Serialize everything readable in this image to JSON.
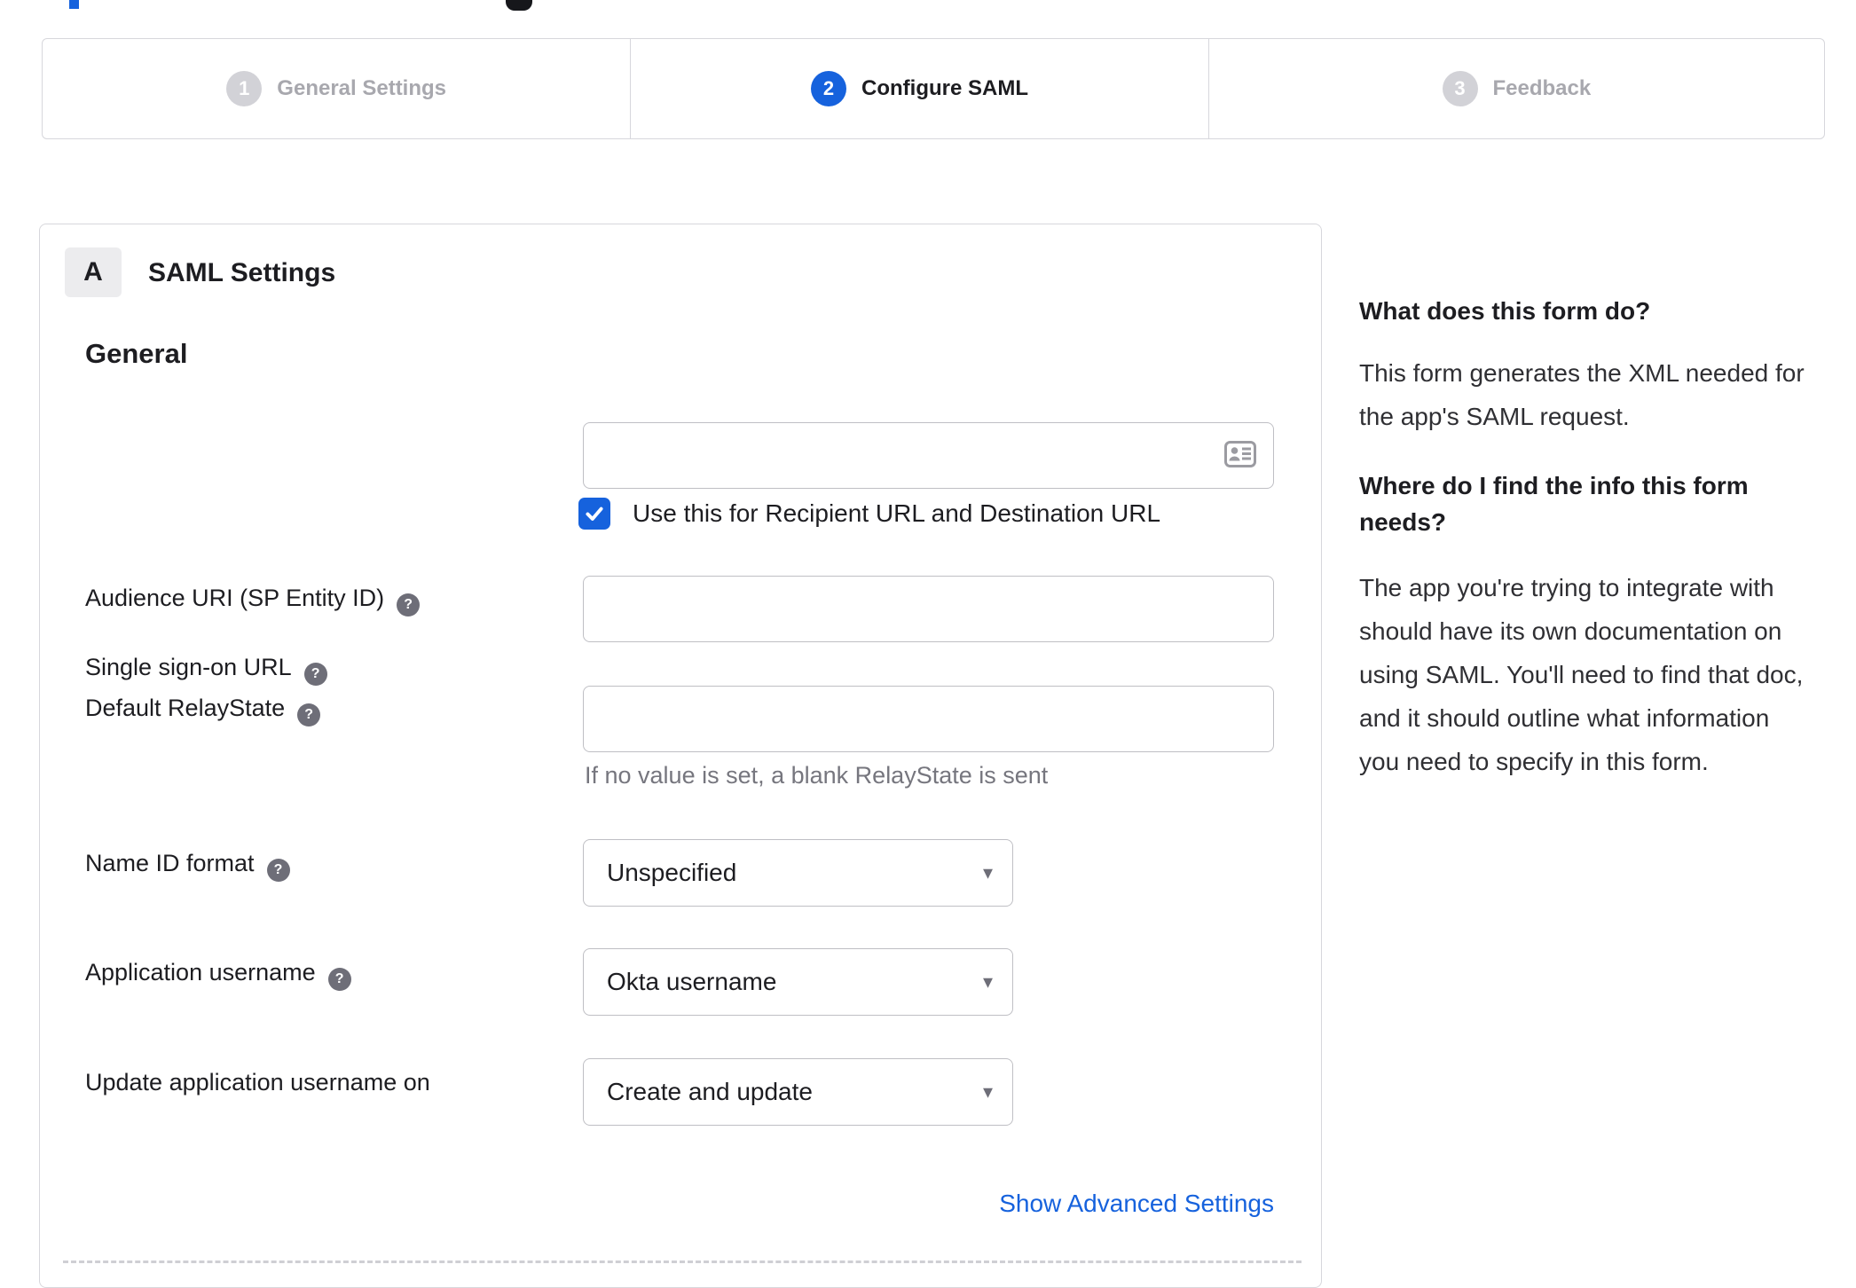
{
  "stepper": {
    "steps": [
      {
        "number": "1",
        "label": "General Settings",
        "state": "inactive"
      },
      {
        "number": "2",
        "label": "Configure SAML",
        "state": "active"
      },
      {
        "number": "3",
        "label": "Feedback",
        "state": "inactive"
      }
    ]
  },
  "panel": {
    "section_badge": "A",
    "section_title": "SAML Settings",
    "group_title": "General",
    "fields": [
      {
        "label": "Single sign-on URL",
        "type": "text",
        "value": "",
        "checkbox": {
          "checked": true,
          "label": "Use this for Recipient URL and Destination URL"
        }
      },
      {
        "label": "Audience URI (SP Entity ID)",
        "type": "text",
        "value": ""
      },
      {
        "label": "Default RelayState",
        "type": "text",
        "value": "",
        "hint": "If no value is set, a blank RelayState is sent"
      },
      {
        "label": "Name ID format",
        "type": "select",
        "value": "Unspecified"
      },
      {
        "label": "Application username",
        "type": "select",
        "value": "Okta username"
      },
      {
        "label": "Update application username on",
        "type": "select",
        "value": "Create and update"
      }
    ],
    "advanced_link": "Show Advanced Settings"
  },
  "sidebar": {
    "sections": [
      {
        "heading": "What does this form do?",
        "body": "This form generates the XML needed for the app's SAML request."
      },
      {
        "heading": "Where do I find the info this form needs?",
        "body": "The app you're trying to integrate with should have its own documentation on using SAML. You'll need to find that doc, and it should outline what information you need to specify in this form."
      }
    ]
  },
  "icons": {
    "help_glyph": "?",
    "caret_glyph": "▾"
  },
  "colors": {
    "accent_blue": "#1662dd",
    "active_text": "#1d1d21",
    "inactive_text": "#a8a8ae",
    "inactive_badge": "#d2d2d7",
    "border_gray": "#d7d7dc",
    "input_border": "#bfbfc4",
    "help_icon_gray": "#6e6e78",
    "hint_gray": "#76767e"
  }
}
